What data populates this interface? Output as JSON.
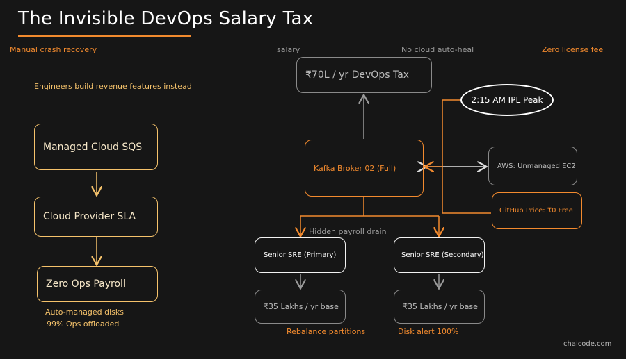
{
  "title": "The Invisible DevOps Salary Tax",
  "notes": {
    "manual_crash_recovery": "Manual crash recovery",
    "salary": "salary",
    "no_cloud_auto_heal": "No cloud auto-heal",
    "zero_license_fee": "Zero license fee",
    "engineers_build": "Engineers build revenue features instead",
    "hidden_payroll_drain": "Hidden payroll drain",
    "auto_managed_disks": "Auto-managed disks",
    "ops_offloaded": "99% Ops offloaded",
    "rebalance_partitions": "Rebalance partitions",
    "disk_alert": "Disk alert 100%"
  },
  "nodes": {
    "managed_cloud_sqs": "Managed Cloud SQS",
    "cloud_provider_sla": "Cloud Provider SLA",
    "zero_ops_payroll": "Zero Ops Payroll",
    "devops_tax": "₹70L / yr DevOps Tax",
    "ipl_peak": "2:15 AM IPL Peak",
    "kafka_broker": "Kafka Broker 02 (Full)",
    "aws_ec2": "AWS: Unmanaged EC2",
    "github_price": "GitHub Price: ₹0 Free",
    "sre_primary": "Senior SRE (Primary)",
    "sre_secondary": "Senior SRE (Secondary)",
    "sre_primary_cost": "₹35 Lakhs / yr base",
    "sre_secondary_cost": "₹35 Lakhs / yr base"
  },
  "watermark": "chaicode.com",
  "colors": {
    "background": "#161616",
    "accent_orange": "#f28a2e",
    "accent_yellow": "#f5c26b",
    "neutral_grey": "#8a8a8a"
  }
}
